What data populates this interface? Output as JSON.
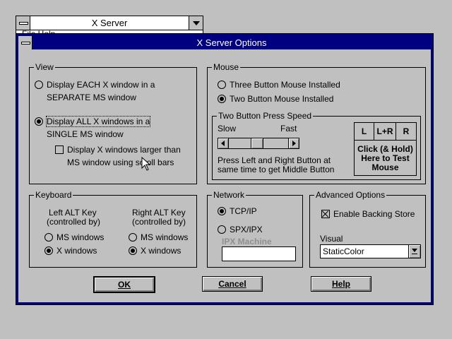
{
  "background_window": {
    "title": "X Server",
    "menu_text": "File   Help"
  },
  "dialog": {
    "title": "X Server Options",
    "view": {
      "caption": "View",
      "option1_line1": "Display EACH X window in a",
      "option1_line2": "SEPARATE MS window",
      "option2_line1": "Display ALL X windows in a",
      "option2_line2": "SINGLE MS window",
      "selected": "option2",
      "scrollbars_line1": "Display X windows larger than",
      "scrollbars_line2": "MS window using scroll bars",
      "scrollbars_checked": false
    },
    "mouse": {
      "caption": "Mouse",
      "option_three": "Three Button Mouse Installed",
      "option_two": "Two Button Mouse Installed",
      "selected": "two",
      "speed": {
        "caption": "Two Button Press Speed",
        "slow": "Slow",
        "fast": "Fast",
        "level": 0.45,
        "hint_line1": "Press Left and Right Button at",
        "hint_line2": "same time to get Middle Button"
      },
      "test": {
        "left": "L",
        "both": "L+R",
        "right": "R",
        "line1": "Click (& Hold)",
        "line2": "Here to Test",
        "line3": "Mouse"
      }
    },
    "keyboard": {
      "caption": "Keyboard",
      "left_line1": "Left ALT Key",
      "left_line2": "(controlled by)",
      "right_line1": "Right ALT Key",
      "right_line2": "(controlled by)",
      "ms": "MS windows",
      "x": "X windows",
      "left_selected": "x",
      "right_selected": "x"
    },
    "network": {
      "caption": "Network",
      "tcp": "TCP/IP",
      "spx": "SPX/IPX",
      "selected": "tcp",
      "ipx_label": "IPX Machine",
      "ipx_value": ""
    },
    "advanced": {
      "caption": "Advanced Options",
      "backing_store": "Enable Backing Store",
      "backing_checked": true,
      "visual_label": "Visual",
      "visual_value": "StaticColor"
    },
    "buttons": {
      "ok": "OK",
      "cancel": "Cancel",
      "help": "Help"
    }
  }
}
